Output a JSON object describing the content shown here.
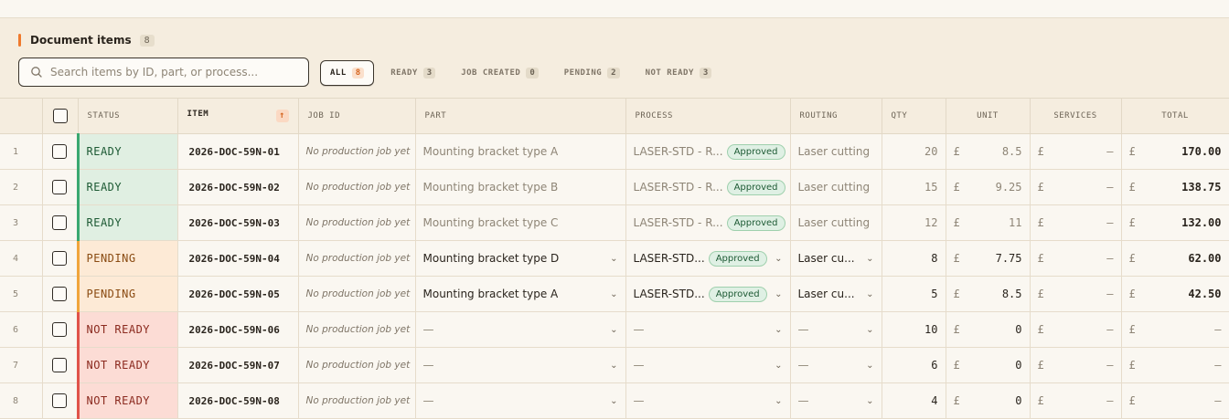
{
  "header": {
    "title": "Document items",
    "count": "8"
  },
  "search": {
    "placeholder": "Search items by ID, part, or process..."
  },
  "filters": [
    {
      "label": "ALL",
      "count": "8",
      "active": true
    },
    {
      "label": "READY",
      "count": "3"
    },
    {
      "label": "JOB CREATED",
      "count": "0"
    },
    {
      "label": "PENDING",
      "count": "2"
    },
    {
      "label": "NOT READY",
      "count": "3"
    }
  ],
  "columns": {
    "status": "STATUS",
    "item": "ITEM",
    "job_id": "JOB ID",
    "part": "PART",
    "process": "PROCESS",
    "routing": "ROUTING",
    "qty": "QTY",
    "unit": "UNIT",
    "services": "SERVICES",
    "total": "TOTAL"
  },
  "currency": "£",
  "rows": [
    {
      "num": "1",
      "status": "READY",
      "item": "2026-DOC-59N-01",
      "job_id": "No production job yet",
      "part": "Mounting bracket type A",
      "process": "LASER-STD - R...",
      "approval": "Approved",
      "routing": "Laser cutting",
      "qty": "20",
      "unit": "8.5",
      "services": "—",
      "total": "170.00"
    },
    {
      "num": "2",
      "status": "READY",
      "item": "2026-DOC-59N-02",
      "job_id": "No production job yet",
      "part": "Mounting bracket type B",
      "process": "LASER-STD - R...",
      "approval": "Approved",
      "routing": "Laser cutting",
      "qty": "15",
      "unit": "9.25",
      "services": "—",
      "total": "138.75"
    },
    {
      "num": "3",
      "status": "READY",
      "item": "2026-DOC-59N-03",
      "job_id": "No production job yet",
      "part": "Mounting bracket type C",
      "process": "LASER-STD - R...",
      "approval": "Approved",
      "routing": "Laser cutting",
      "qty": "12",
      "unit": "11",
      "services": "—",
      "total": "132.00"
    },
    {
      "num": "4",
      "status": "PENDING",
      "item": "2026-DOC-59N-04",
      "job_id": "No production job yet",
      "part": "Mounting bracket type D",
      "process": "LASER-STD...",
      "approval": "Approved",
      "routing": "Laser cu...",
      "qty": "8",
      "unit": "7.75",
      "services": "—",
      "total": "62.00"
    },
    {
      "num": "5",
      "status": "PENDING",
      "item": "2026-DOC-59N-05",
      "job_id": "No production job yet",
      "part": "Mounting bracket type A",
      "process": "LASER-STD...",
      "approval": "Approved",
      "routing": "Laser cu...",
      "qty": "5",
      "unit": "8.5",
      "services": "—",
      "total": "42.50"
    },
    {
      "num": "6",
      "status": "NOT READY",
      "item": "2026-DOC-59N-06",
      "job_id": "No production job yet",
      "part": "—",
      "process": "—",
      "approval": "",
      "routing": "—",
      "qty": "10",
      "unit": "0",
      "services": "—",
      "total": "—"
    },
    {
      "num": "7",
      "status": "NOT READY",
      "item": "2026-DOC-59N-07",
      "job_id": "No production job yet",
      "part": "—",
      "process": "—",
      "approval": "",
      "routing": "—",
      "qty": "6",
      "unit": "0",
      "services": "—",
      "total": "—"
    },
    {
      "num": "8",
      "status": "NOT READY",
      "item": "2026-DOC-59N-08",
      "job_id": "No production job yet",
      "part": "—",
      "process": "—",
      "approval": "",
      "routing": "—",
      "qty": "4",
      "unit": "0",
      "services": "—",
      "total": "—"
    }
  ],
  "colors": {
    "accent": "#ef7a2d",
    "ready": "#3aa870",
    "pending": "#f0a53c",
    "not_ready": "#e0534a"
  }
}
